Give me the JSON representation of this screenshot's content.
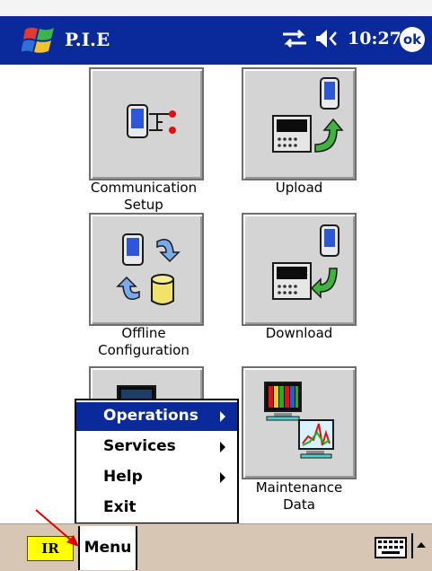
{
  "titlebar": {
    "title": "P.I.E",
    "time": "10:27",
    "ok_label": "ok"
  },
  "tiles": [
    {
      "label_line1": "Communication",
      "label_line2": "Setup",
      "icon": "communication-setup-icon"
    },
    {
      "label_line1": "Upload",
      "label_line2": "",
      "icon": "upload-icon"
    },
    {
      "label_line1": "Offline",
      "label_line2": "Configuration",
      "icon": "offline-configuration-icon"
    },
    {
      "label_line1": "Download",
      "label_line2": "",
      "icon": "download-icon"
    },
    {
      "label_line1": "Maintenance",
      "label_line2": "Data",
      "icon": "maintenance-data-icon"
    }
  ],
  "menu": {
    "items": [
      {
        "label": "Operations",
        "submenu": true,
        "selected": true
      },
      {
        "label": "Services",
        "submenu": true,
        "selected": false
      },
      {
        "label": "Help",
        "submenu": true,
        "selected": false
      },
      {
        "label": "Exit",
        "submenu": false,
        "selected": false
      }
    ]
  },
  "taskbar": {
    "ir_label": "IR",
    "menu_label": "Menu"
  },
  "colors": {
    "titlebar": "#0a2a9b",
    "selected_menu": "#0a2a9b",
    "taskbar": "#d8c6b5",
    "ir_badge": "#ffff00",
    "annotation_arrow": "#e00000"
  }
}
